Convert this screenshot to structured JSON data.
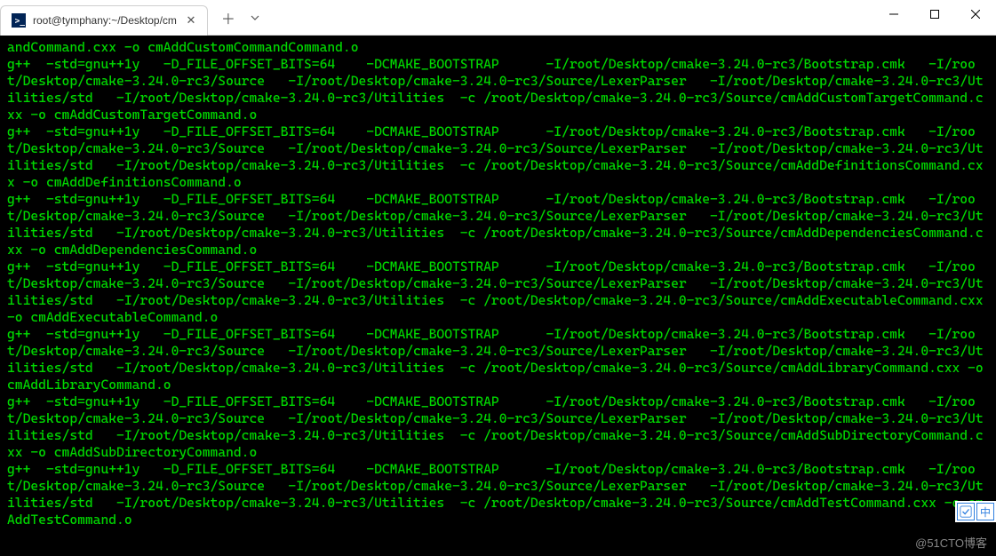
{
  "window": {
    "tab_title": "root@tymphany:~/Desktop/cm",
    "watermark": "@51CTO博客",
    "ime": {
      "left": "✓",
      "right": "中"
    }
  },
  "terminal": {
    "lines": [
      "andCommand.cxx -o cmAddCustomCommandCommand.o",
      "g++  -std=gnu++1y   -D_FILE_OFFSET_BITS=64    -DCMAKE_BOOTSTRAP      -I/root/Desktop/cmake-3.24.0-rc3/Bootstrap.cmk   -I/root/Desktop/cmake-3.24.0-rc3/Source   -I/root/Desktop/cmake-3.24.0-rc3/Source/LexerParser   -I/root/Desktop/cmake-3.24.0-rc3/Utilities/std   -I/root/Desktop/cmake-3.24.0-rc3/Utilities  -c /root/Desktop/cmake-3.24.0-rc3/Source/cmAddCustomTargetCommand.cxx -o cmAddCustomTargetCommand.o",
      "g++  -std=gnu++1y   -D_FILE_OFFSET_BITS=64    -DCMAKE_BOOTSTRAP      -I/root/Desktop/cmake-3.24.0-rc3/Bootstrap.cmk   -I/root/Desktop/cmake-3.24.0-rc3/Source   -I/root/Desktop/cmake-3.24.0-rc3/Source/LexerParser   -I/root/Desktop/cmake-3.24.0-rc3/Utilities/std   -I/root/Desktop/cmake-3.24.0-rc3/Utilities  -c /root/Desktop/cmake-3.24.0-rc3/Source/cmAddDefinitionsCommand.cxx -o cmAddDefinitionsCommand.o",
      "g++  -std=gnu++1y   -D_FILE_OFFSET_BITS=64    -DCMAKE_BOOTSTRAP      -I/root/Desktop/cmake-3.24.0-rc3/Bootstrap.cmk   -I/root/Desktop/cmake-3.24.0-rc3/Source   -I/root/Desktop/cmake-3.24.0-rc3/Source/LexerParser   -I/root/Desktop/cmake-3.24.0-rc3/Utilities/std   -I/root/Desktop/cmake-3.24.0-rc3/Utilities  -c /root/Desktop/cmake-3.24.0-rc3/Source/cmAddDependenciesCommand.cxx -o cmAddDependenciesCommand.o",
      "g++  -std=gnu++1y   -D_FILE_OFFSET_BITS=64    -DCMAKE_BOOTSTRAP      -I/root/Desktop/cmake-3.24.0-rc3/Bootstrap.cmk   -I/root/Desktop/cmake-3.24.0-rc3/Source   -I/root/Desktop/cmake-3.24.0-rc3/Source/LexerParser   -I/root/Desktop/cmake-3.24.0-rc3/Utilities/std   -I/root/Desktop/cmake-3.24.0-rc3/Utilities  -c /root/Desktop/cmake-3.24.0-rc3/Source/cmAddExecutableCommand.cxx -o cmAddExecutableCommand.o",
      "g++  -std=gnu++1y   -D_FILE_OFFSET_BITS=64    -DCMAKE_BOOTSTRAP      -I/root/Desktop/cmake-3.24.0-rc3/Bootstrap.cmk   -I/root/Desktop/cmake-3.24.0-rc3/Source   -I/root/Desktop/cmake-3.24.0-rc3/Source/LexerParser   -I/root/Desktop/cmake-3.24.0-rc3/Utilities/std   -I/root/Desktop/cmake-3.24.0-rc3/Utilities  -c /root/Desktop/cmake-3.24.0-rc3/Source/cmAddLibraryCommand.cxx -o cmAddLibraryCommand.o",
      "g++  -std=gnu++1y   -D_FILE_OFFSET_BITS=64    -DCMAKE_BOOTSTRAP      -I/root/Desktop/cmake-3.24.0-rc3/Bootstrap.cmk   -I/root/Desktop/cmake-3.24.0-rc3/Source   -I/root/Desktop/cmake-3.24.0-rc3/Source/LexerParser   -I/root/Desktop/cmake-3.24.0-rc3/Utilities/std   -I/root/Desktop/cmake-3.24.0-rc3/Utilities  -c /root/Desktop/cmake-3.24.0-rc3/Source/cmAddSubDirectoryCommand.cxx -o cmAddSubDirectoryCommand.o",
      "g++  -std=gnu++1y   -D_FILE_OFFSET_BITS=64    -DCMAKE_BOOTSTRAP      -I/root/Desktop/cmake-3.24.0-rc3/Bootstrap.cmk   -I/root/Desktop/cmake-3.24.0-rc3/Source   -I/root/Desktop/cmake-3.24.0-rc3/Source/LexerParser   -I/root/Desktop/cmake-3.24.0-rc3/Utilities/std   -I/root/Desktop/cmake-3.24.0-rc3/Utilities  -c /root/Desktop/cmake-3.24.0-rc3/Source/cmAddTestCommand.cxx -o cmAddTestCommand.o"
    ]
  }
}
